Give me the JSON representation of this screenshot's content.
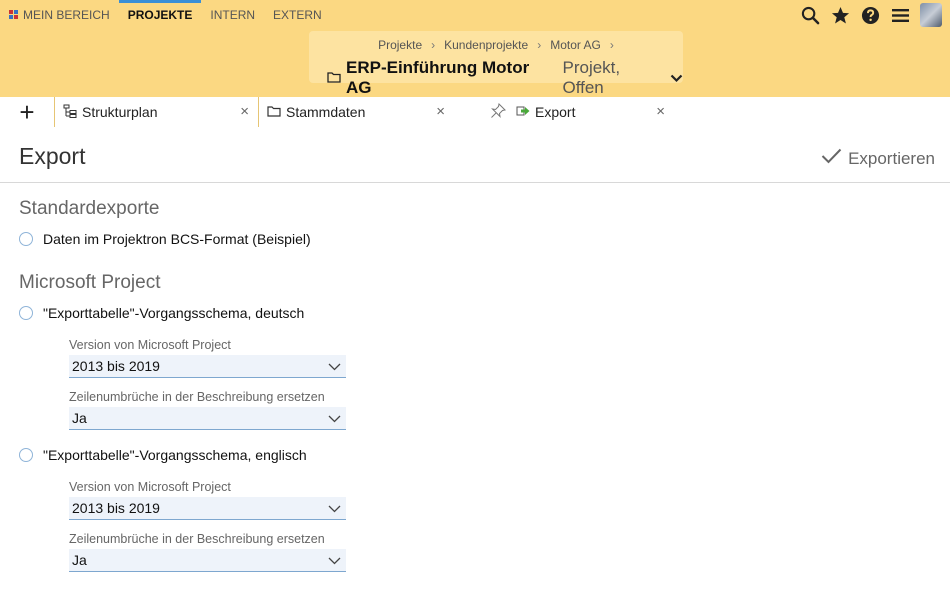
{
  "nav": {
    "items": [
      {
        "label": "MEIN BEREICH",
        "icon": "grid-icon"
      },
      {
        "label": "PROJEKTE",
        "active": true
      },
      {
        "label": "INTERN"
      },
      {
        "label": "EXTERN"
      }
    ]
  },
  "topIcons": [
    "search-icon",
    "star-icon",
    "help-icon",
    "menu-icon",
    "avatar"
  ],
  "breadcrumb": {
    "items": [
      "Projekte",
      "Kundenprojekte",
      "Motor AG"
    ],
    "separator": "›",
    "projectName": "ERP-Einführung Motor AG",
    "projectStatus": "Projekt, Offen"
  },
  "tabs": {
    "addLabel": "+",
    "items": [
      {
        "label": "Strukturplan",
        "icon": "tree-icon"
      },
      {
        "label": "Stammdaten",
        "icon": "folder-icon"
      },
      {
        "label": "Export",
        "icon": "export-icon",
        "active": true,
        "pin": true
      }
    ],
    "closeLabel": "×"
  },
  "page": {
    "title": "Export",
    "exportButton": "Exportieren"
  },
  "sections": {
    "standard": {
      "title": "Standardexporte",
      "option": "Daten im Projektron BCS-Format (Beispiel)"
    },
    "msproject": {
      "title": "Microsoft Project",
      "options": [
        {
          "label": "\"Exporttabelle\"-Vorgangsschema, deutsch",
          "versionLabel": "Version von Microsoft Project",
          "versionValue": "2013 bis 2019",
          "breakLabel": "Zeilenumbrüche in der Beschreibung ersetzen",
          "breakValue": "Ja"
        },
        {
          "label": "\"Exporttabelle\"-Vorgangsschema, englisch",
          "versionLabel": "Version von Microsoft Project",
          "versionValue": "2013 bis 2019",
          "breakLabel": "Zeilenumbrüche in der Beschreibung ersetzen",
          "breakValue": "Ja"
        }
      ]
    }
  },
  "colors": {
    "header": "#fbd882",
    "accent": "#3a8fd6",
    "fieldBg": "#eef3fa"
  }
}
